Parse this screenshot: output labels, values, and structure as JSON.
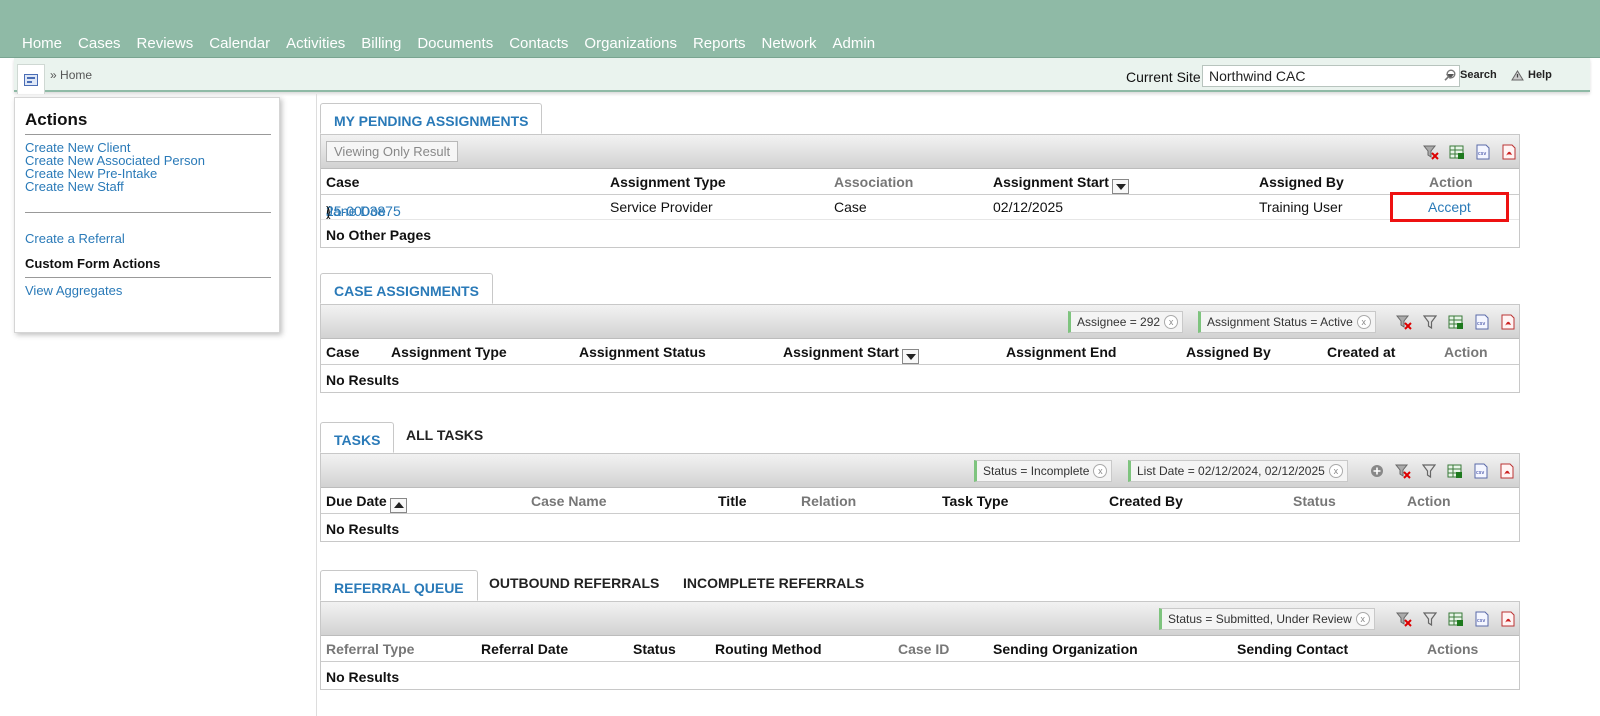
{
  "nav": {
    "items": [
      "Home",
      "Cases",
      "Reviews",
      "Calendar",
      "Activities",
      "Billing",
      "Documents",
      "Contacts",
      "Organizations",
      "Reports",
      "Network",
      "Admin"
    ]
  },
  "breadcrumb": {
    "sep": "»",
    "label": "Home"
  },
  "site": {
    "label": "Current Site",
    "value": "Northwind CAC"
  },
  "toolbar": {
    "search": "Search",
    "help": "Help"
  },
  "actions": {
    "title": "Actions",
    "links": [
      "Create New Client",
      "Create New Associated Person",
      "Create New Pre-Intake",
      "Create New Staff"
    ],
    "referral": "Create a Referral",
    "custom_form": "Custom Form Actions",
    "aggregates": "View Aggregates"
  },
  "pending": {
    "tab": "MY PENDING ASSIGNMENTS",
    "viewing": "Viewing Only Result",
    "columns": [
      "Case",
      "Assignment Type",
      "Association",
      "Assignment Start",
      "Assigned By",
      "Action"
    ],
    "row": {
      "case_name": "Jane Doe",
      "case_open": " (",
      "case_id": "25-0003875",
      "case_close": ")",
      "type": "Service Provider",
      "association": "Case",
      "start": "02/12/2025",
      "assigned_by": "Training User",
      "action": "Accept"
    },
    "footer": "No Other Pages"
  },
  "case_assign": {
    "tab": "CASE ASSIGNMENTS",
    "filters": [
      "Assignee = 292",
      "Assignment Status = Active"
    ],
    "columns": [
      "Case",
      "Assignment Type",
      "Assignment Status",
      "Assignment Start",
      "Assignment End",
      "Assigned By",
      "Created at",
      "Action"
    ],
    "footer": "No Results"
  },
  "tasks": {
    "tabs": [
      "TASKS",
      "ALL TASKS"
    ],
    "filters": [
      "Status = Incomplete",
      "List Date = 02/12/2024, 02/12/2025"
    ],
    "columns": [
      "Due Date",
      "Case Name",
      "Title",
      "Relation",
      "Task Type",
      "Created By",
      "Status",
      "Action"
    ],
    "footer": "No Results"
  },
  "referrals": {
    "tabs": [
      "REFERRAL QUEUE",
      "OUTBOUND REFERRALS",
      "INCOMPLETE REFERRALS"
    ],
    "filters": [
      "Status = Submitted, Under Review"
    ],
    "columns": [
      "Referral Type",
      "Referral Date",
      "Status",
      "Routing Method",
      "Case ID",
      "Sending Organization",
      "Sending Contact",
      "Actions"
    ],
    "footer": "No Results"
  },
  "icons": {
    "clear_filter": "clear-filter-icon",
    "filter": "filter-icon",
    "excel": "excel-export-icon",
    "csv": "csv-export-icon",
    "pdf": "pdf-export-icon",
    "add": "add-filter-icon"
  }
}
